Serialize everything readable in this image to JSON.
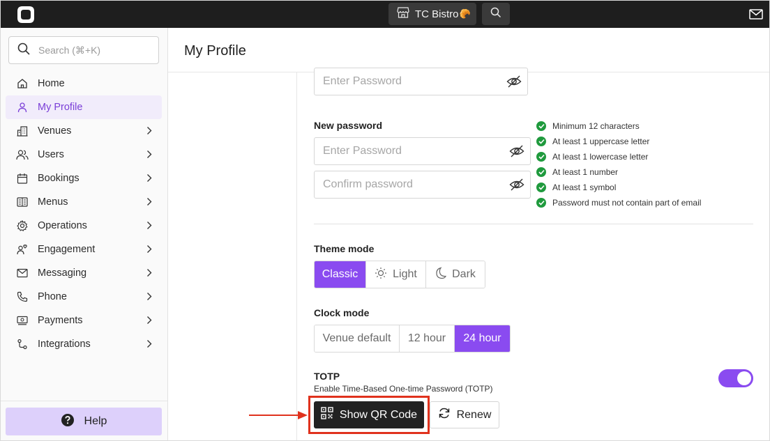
{
  "topbar": {
    "venue_name": "TC Bistro",
    "venue_emoji": "🥐",
    "icons": [
      "app-logo-icon",
      "store-icon",
      "search-icon",
      "mail-icon"
    ]
  },
  "sidebar": {
    "search_placeholder": "Search (⌘+K)",
    "items": [
      {
        "label": "Home",
        "icon": "home-icon",
        "has_chevron": false,
        "active": false
      },
      {
        "label": "My Profile",
        "icon": "user-icon",
        "has_chevron": false,
        "active": true
      },
      {
        "label": "Venues",
        "icon": "building-icon",
        "has_chevron": true,
        "active": false
      },
      {
        "label": "Users",
        "icon": "users-icon",
        "has_chevron": true,
        "active": false
      },
      {
        "label": "Bookings",
        "icon": "calendar-icon",
        "has_chevron": true,
        "active": false
      },
      {
        "label": "Menus",
        "icon": "menu-book-icon",
        "has_chevron": true,
        "active": false
      },
      {
        "label": "Operations",
        "icon": "gear-icon",
        "has_chevron": true,
        "active": false
      },
      {
        "label": "Engagement",
        "icon": "engagement-icon",
        "has_chevron": true,
        "active": false
      },
      {
        "label": "Messaging",
        "icon": "envelope-icon",
        "has_chevron": true,
        "active": false
      },
      {
        "label": "Phone",
        "icon": "phone-icon",
        "has_chevron": true,
        "active": false
      },
      {
        "label": "Payments",
        "icon": "payments-icon",
        "has_chevron": true,
        "active": false
      },
      {
        "label": "Integrations",
        "icon": "integrations-icon",
        "has_chevron": true,
        "active": false
      }
    ],
    "help_label": "Help"
  },
  "main": {
    "page_title": "My Profile",
    "current_password_placeholder": "Enter Password",
    "new_password_label": "New password",
    "new_password_placeholder": "Enter Password",
    "confirm_password_placeholder": "Confirm password",
    "password_rules": [
      "Minimum 12 characters",
      "At least 1 uppercase letter",
      "At least 1 lowercase letter",
      "At least 1 number",
      "At least 1 symbol",
      "Password must not contain part of email"
    ],
    "theme_mode": {
      "label": "Theme mode",
      "options": [
        "Classic",
        "Light",
        "Dark"
      ],
      "selected": "Classic"
    },
    "clock_mode": {
      "label": "Clock mode",
      "options": [
        "Venue default",
        "12 hour",
        "24 hour"
      ],
      "selected": "24 hour"
    },
    "totp": {
      "label": "TOTP",
      "description": "Enable Time-Based One-time Password (TOTP)",
      "enabled": true,
      "show_qr_label": "Show QR Code",
      "renew_label": "Renew"
    }
  },
  "colors": {
    "accent": "#8a4bf0",
    "active_nav_text": "#7b3fd8",
    "active_nav_bg": "#f1ecfb",
    "help_bg": "#ddd0fb",
    "topbar_bg": "#1e1e1e",
    "check_green": "#1f9a3d",
    "highlight_red": "#e0321d"
  }
}
